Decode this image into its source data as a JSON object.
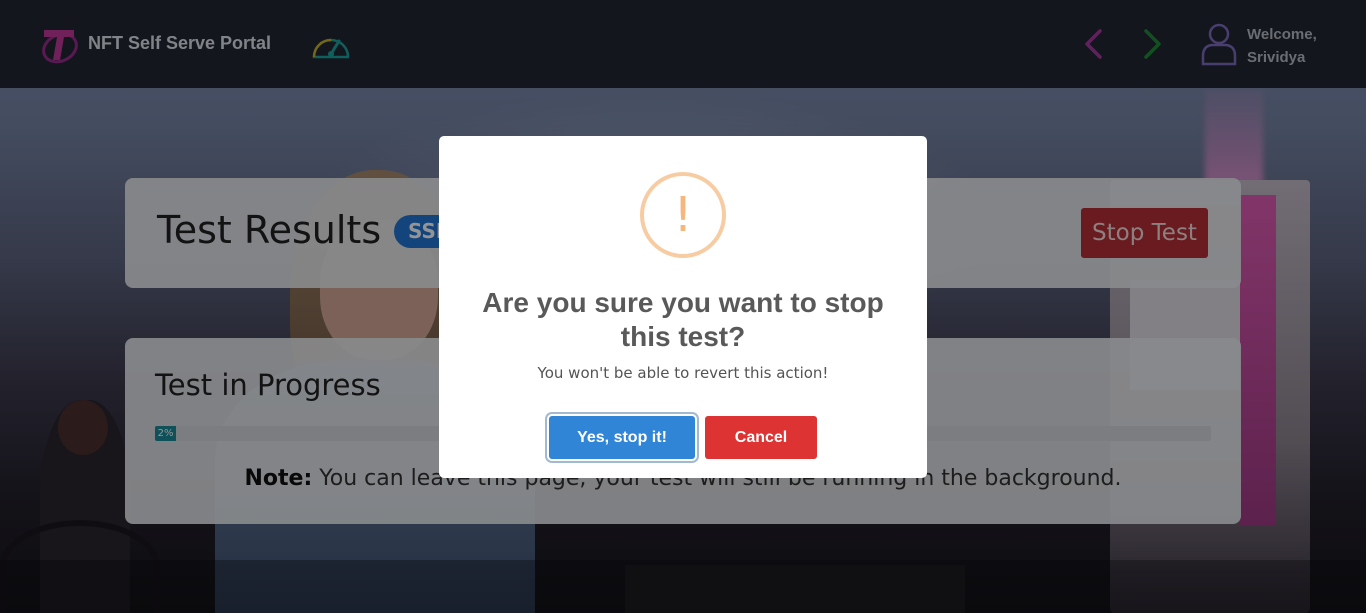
{
  "header": {
    "brand": "NFT Self Serve Portal",
    "welcome_line1": "Welcome,",
    "welcome_line2": "Srividya",
    "icons": {
      "logo": "telstra-logo",
      "dashboard": "speedometer-icon",
      "back": "chevron-left-icon",
      "forward": "chevron-right-icon",
      "user": "user-icon"
    }
  },
  "results": {
    "title": "Test Results",
    "badge": "SSL",
    "stop_button": "Stop Test"
  },
  "progress": {
    "title": "Test in Progress",
    "percent_label": "2%",
    "percent_value": 2,
    "note_bold": "Note:",
    "note_text": " You can leave this page, your test will still be running in the background."
  },
  "modal": {
    "icon": "warning-icon",
    "icon_glyph": "!",
    "title": "Are you sure you want to stop this test?",
    "text": "You won't be able to revert this action!",
    "confirm_label": "Yes, stop it!",
    "cancel_label": "Cancel"
  },
  "colors": {
    "header_bg": "#222631",
    "badge_blue": "#2178d6",
    "stop_red": "#b53038",
    "confirm_blue": "#3085d6",
    "cancel_red": "#dd3333",
    "warning_orange": "#f8bb86",
    "progress_teal": "#1a8a9a"
  }
}
